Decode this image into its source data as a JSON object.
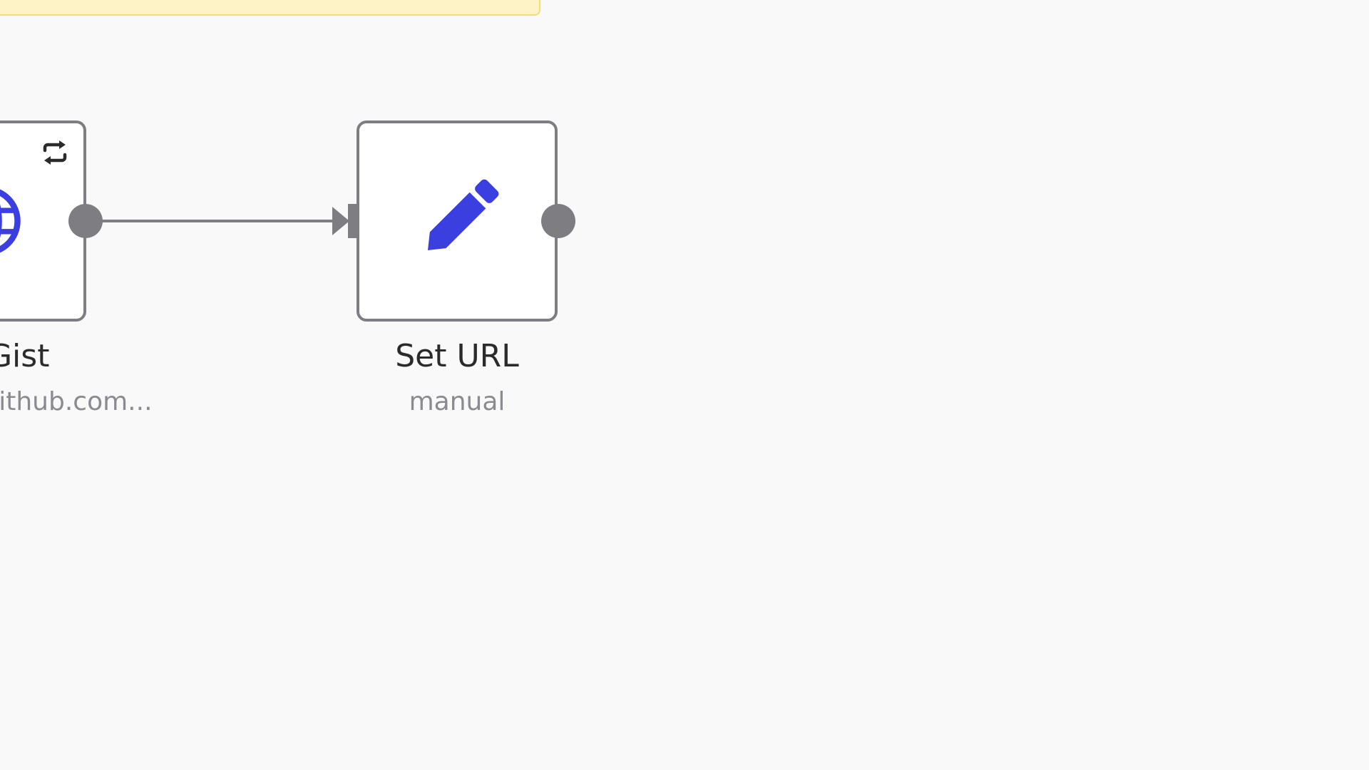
{
  "canvas": {
    "background": "#f9f9f9"
  },
  "sticky_note": {
    "fill": "#fef3c7",
    "border": "#f3dc7c"
  },
  "nodes": [
    {
      "id": "http-request",
      "title": "Get Gist",
      "subtitle": "https://api.github.com...",
      "icon": "globe-icon",
      "badge_icon": "loop-icon",
      "icon_color": "#3b3fe0"
    },
    {
      "id": "set-url",
      "title": "Set URL",
      "subtitle": "manual",
      "icon": "pencil-icon",
      "icon_color": "#3b3fe0"
    }
  ],
  "connection": {
    "from": "http-request",
    "to": "set-url",
    "color": "#7d7d82"
  }
}
